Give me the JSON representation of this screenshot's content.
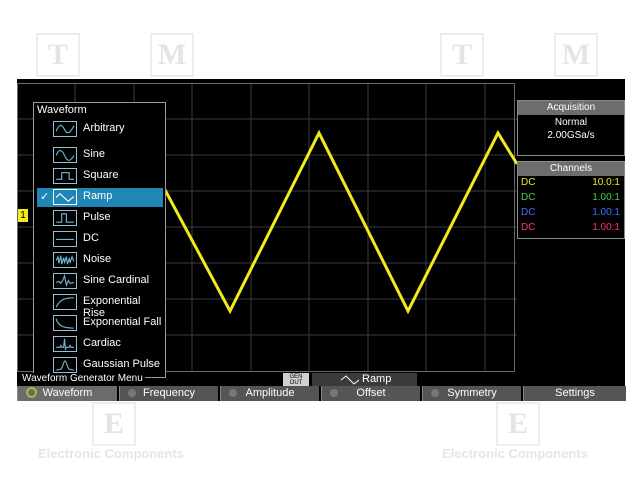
{
  "watermark": {
    "letters": [
      "T",
      "M",
      "E"
    ],
    "text": "Electronic Components"
  },
  "colors": {
    "trace": "#f2ea1a",
    "accent": "#1f86b6",
    "ch1": "#f2ea1a",
    "ch2": "#3fd23f",
    "ch3": "#3f6fff",
    "ch4": "#ff2f7f"
  },
  "acquisition": {
    "title": "Acquisition",
    "mode": "Normal",
    "rate": "2.00GSa/s"
  },
  "channels": {
    "title": "Channels",
    "rows": [
      {
        "coupling": "DC",
        "probe": "10.0:1"
      },
      {
        "coupling": "DC",
        "probe": "1.00:1"
      },
      {
        "coupling": "DC",
        "probe": "1.00:1"
      },
      {
        "coupling": "DC",
        "probe": "1.00:1"
      }
    ]
  },
  "trigger_marker": "1",
  "menu": {
    "title": "Waveform",
    "selected": "Ramp",
    "items": [
      {
        "label": "Arbitrary",
        "icon": "arbitrary-wave-icon"
      },
      {
        "label": "Sine",
        "icon": "sine-wave-icon"
      },
      {
        "label": "Square",
        "icon": "square-wave-icon"
      },
      {
        "label": "Ramp",
        "icon": "ramp-wave-icon"
      },
      {
        "label": "Pulse",
        "icon": "pulse-wave-icon"
      },
      {
        "label": "DC",
        "icon": "dc-wave-icon"
      },
      {
        "label": "Noise",
        "icon": "noise-wave-icon"
      },
      {
        "label": "Sine Cardinal",
        "icon": "sinc-wave-icon"
      },
      {
        "label": "Exponential Rise",
        "icon": "exp-rise-icon"
      },
      {
        "label": "Exponential Fall",
        "icon": "exp-fall-icon"
      },
      {
        "label": "Cardiac",
        "icon": "cardiac-wave-icon"
      },
      {
        "label": "Gaussian Pulse",
        "icon": "gaussian-pulse-icon"
      }
    ],
    "checkmark": "✓"
  },
  "status_bar": {
    "menu_caption": "Waveform Generator Menu",
    "gen_out_line1": "GEN",
    "gen_out_line2": "OUT",
    "wave_name": "Ramp"
  },
  "softkeys": [
    "Waveform",
    "Frequency",
    "Amplitude",
    "Offset",
    "Symmetry",
    "Settings"
  ]
}
